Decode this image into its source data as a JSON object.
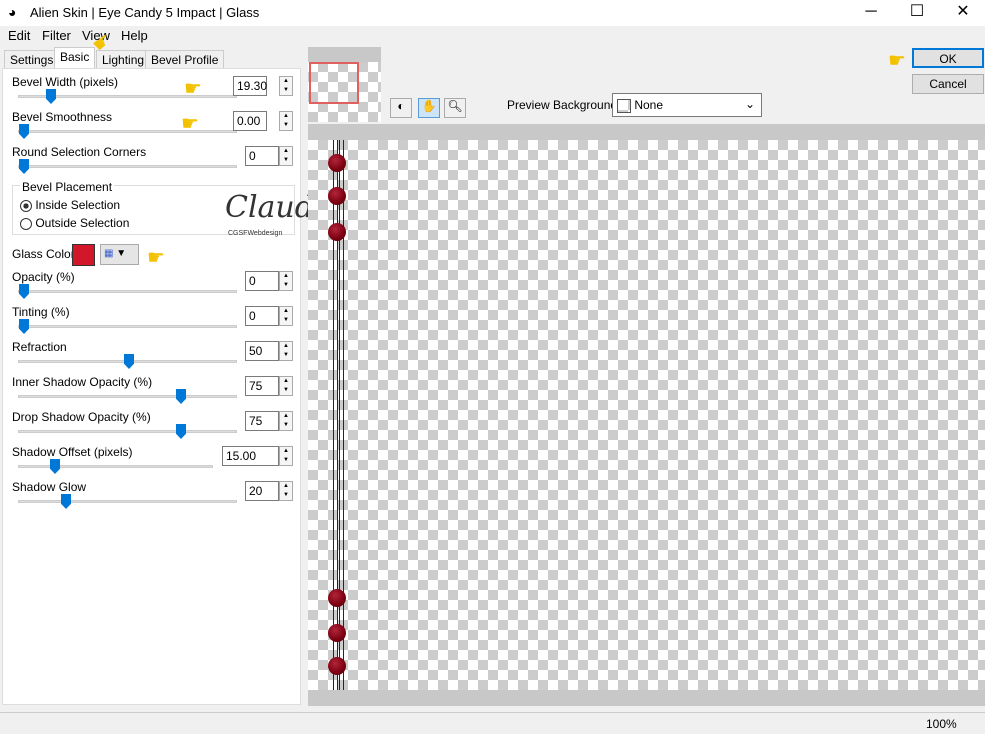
{
  "window": {
    "title": "Alien Skin | Eye Candy 5 Impact | Glass",
    "minimize": "─",
    "maximize": "☐",
    "close": "✕"
  },
  "menu": [
    "Edit",
    "Filter",
    "View",
    "Help"
  ],
  "tabs": [
    {
      "label": "Settings"
    },
    {
      "label": "Basic",
      "active": true
    },
    {
      "label": "Lighting"
    },
    {
      "label": "Bevel Profile"
    }
  ],
  "basic": {
    "bevel_width": {
      "label": "Bevel Width (pixels)",
      "value": "19.30",
      "level": 0.13
    },
    "bevel_smoothness": {
      "label": "Bevel Smoothness",
      "value": "0.00",
      "level": 0
    },
    "round_corners": {
      "label": "Round Selection Corners",
      "value": "0",
      "level": 0
    },
    "bevel_placement": {
      "label": "Bevel Placement",
      "options": [
        "Inside Selection",
        "Outside Selection"
      ],
      "selected": "Inside Selection"
    },
    "glass_color": {
      "label": "Glass Color",
      "color": "#d3172b"
    },
    "opacity": {
      "label": "Opacity (%)",
      "value": "0",
      "level": 0
    },
    "tinting": {
      "label": "Tinting (%)",
      "value": "0",
      "level": 0
    },
    "refraction": {
      "label": "Refraction",
      "value": "50",
      "level": 0.5
    },
    "inner_shadow": {
      "label": "Inner Shadow Opacity (%)",
      "value": "75",
      "level": 0.75
    },
    "drop_shadow": {
      "label": "Drop Shadow Opacity (%)",
      "value": "75",
      "level": 0.75
    },
    "shadow_offset": {
      "label": "Shadow Offset (pixels)",
      "value": "15.00",
      "level": 0.17
    },
    "shadow_glow": {
      "label": "Shadow Glow",
      "value": "20",
      "level": 0.2
    }
  },
  "watermark": {
    "name": "Claudia",
    "sub": "CGSFWebdesign"
  },
  "preview": {
    "bg_label": "Preview Background:",
    "bg_value": "None"
  },
  "buttons": {
    "ok": "OK",
    "cancel": "Cancel"
  },
  "status": {
    "zoom": "100%"
  }
}
